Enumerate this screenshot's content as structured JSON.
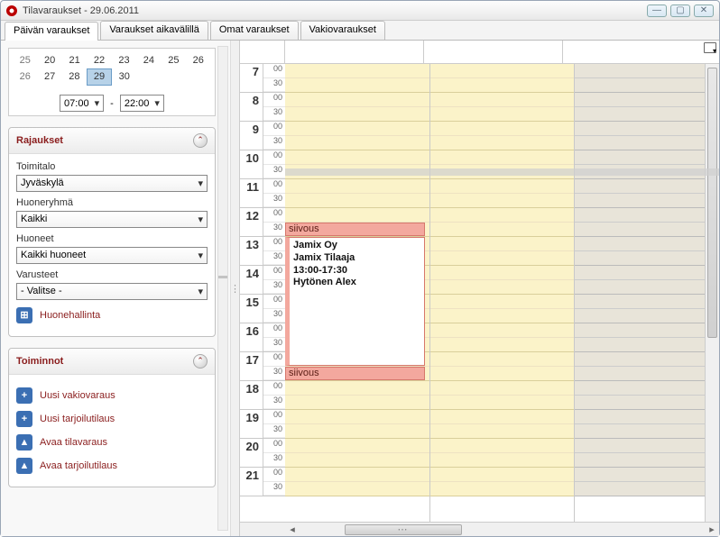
{
  "window": {
    "title": "Tilavaraukset - 29.06.2011"
  },
  "tabs": {
    "t0": "Päivän varaukset",
    "t1": "Varaukset aikavälillä",
    "t2": "Omat varaukset",
    "t3": "Vakiovaraukset"
  },
  "minical": {
    "weeks": [
      {
        "wk": "25",
        "d": [
          "20",
          "21",
          "22",
          "23",
          "24",
          "25",
          "26"
        ]
      },
      {
        "wk": "26",
        "d": [
          "27",
          "28",
          "29",
          "30",
          "",
          "",
          ""
        ]
      }
    ],
    "selected_day": "29"
  },
  "time_range": {
    "from": "07:00",
    "sep": "-",
    "to": "22:00"
  },
  "panels": {
    "rajaukset": {
      "title": "Rajaukset",
      "fields": {
        "toimitalo_label": "Toimitalo",
        "toimitalo_value": "Jyväskylä",
        "huoneryhma_label": "Huoneryhmä",
        "huoneryhma_value": "Kaikki",
        "huoneet_label": "Huoneet",
        "huoneet_value": "Kaikki huoneet",
        "varusteet_label": "Varusteet",
        "varusteet_value": "- Valitse -"
      },
      "link": "Huonehallinta"
    },
    "toiminnot": {
      "title": "Toiminnot",
      "actions": {
        "a0": "Uusi vakiovaraus",
        "a1": "Uusi tarjoilutilaus",
        "a2": "Avaa tilavaraus",
        "a3": "Avaa tarjoilutilaus"
      }
    }
  },
  "schedule": {
    "hours": [
      "7",
      "8",
      "9",
      "10",
      "11",
      "12",
      "13",
      "14",
      "15",
      "16",
      "17",
      "18",
      "19",
      "20",
      "21"
    ],
    "half_labels": {
      "h0": "00",
      "h1": "30"
    },
    "events": {
      "siivous_top": "siivous",
      "siivous_bottom": "siivous",
      "booking": {
        "line1": "Jamix Oy",
        "line2": "Jamix Tilaaja",
        "line3": "13:00-17:30",
        "line4": "Hytönen Alex"
      }
    }
  }
}
